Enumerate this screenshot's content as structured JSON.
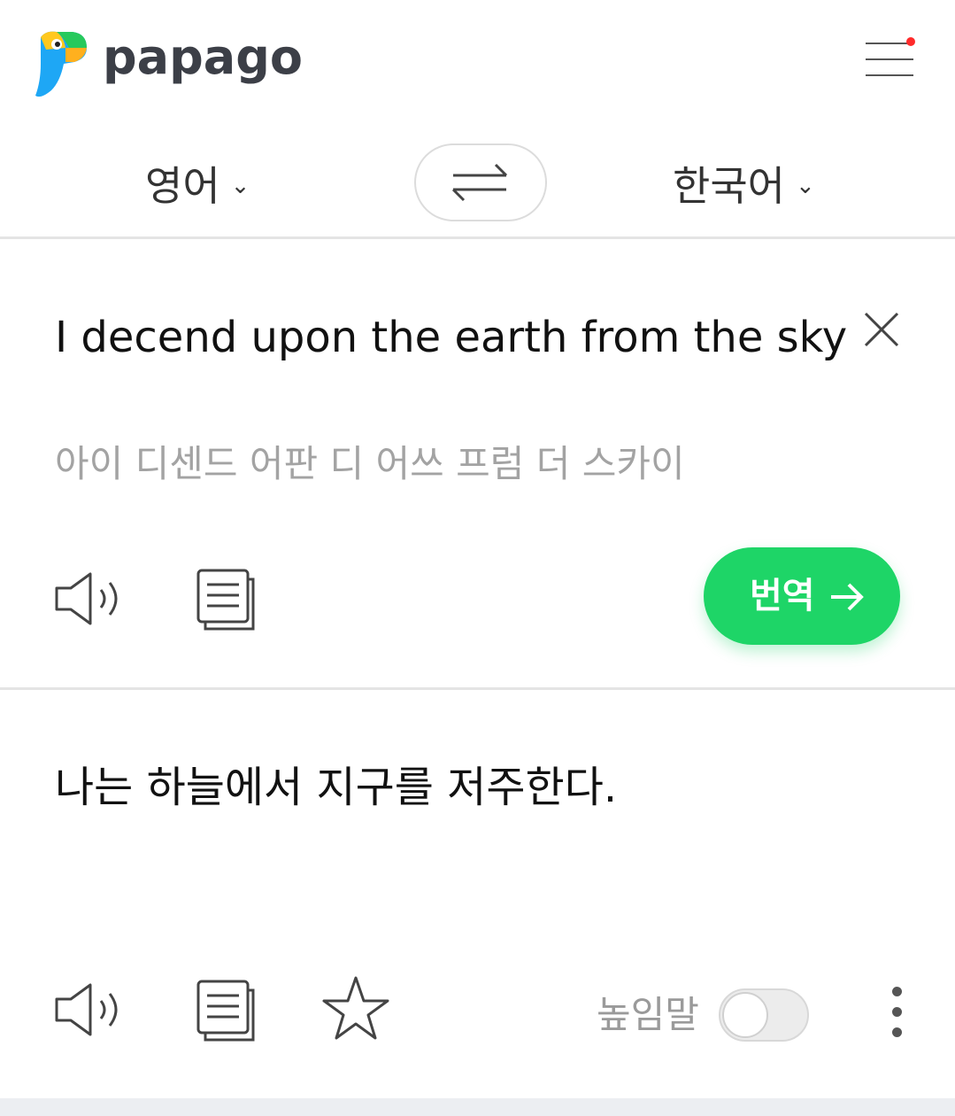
{
  "app": {
    "brand": "papago"
  },
  "header": {
    "menu_icon": "hamburger-menu-icon",
    "notification_dot_color": "#ff2a2a"
  },
  "languages": {
    "source": "영어",
    "target": "한국어",
    "swap_icon": "swap-arrows-icon"
  },
  "source": {
    "text": "I decend upon the earth from the sky",
    "pronunciation": "아이 디센드 어판 디 어쓰 프럼 더 스카이",
    "clear_icon": "close-icon",
    "speak_icon": "speaker-icon",
    "copy_icon": "copy-icon"
  },
  "translate_button": {
    "label": "번역",
    "color": "#1ed567"
  },
  "result": {
    "text": "나는 하늘에서 지구를 저주한다.",
    "honorific_label": "높임말",
    "honorific_enabled": false,
    "speak_icon": "speaker-icon",
    "copy_icon": "copy-icon",
    "favorite_icon": "star-icon",
    "more_icon": "more-vertical-icon"
  }
}
